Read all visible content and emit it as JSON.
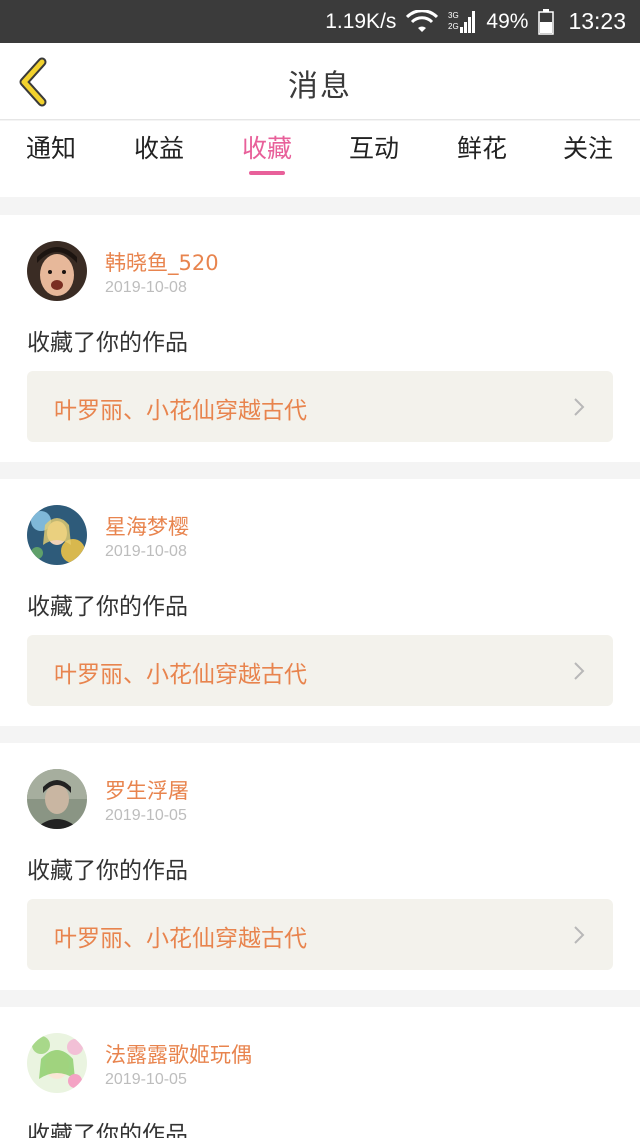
{
  "status_bar": {
    "net_speed": "1.19K/s",
    "network": "3G 2G",
    "battery": "49%",
    "time": "13:23"
  },
  "header": {
    "title": "消息",
    "back_icon": "chevron-left-icon"
  },
  "tabs": [
    {
      "label": "通知",
      "active": false
    },
    {
      "label": "收益",
      "active": false
    },
    {
      "label": "收藏",
      "active": true
    },
    {
      "label": "互动",
      "active": false
    },
    {
      "label": "鲜花",
      "active": false
    },
    {
      "label": "关注",
      "active": false
    }
  ],
  "messages": [
    {
      "username": "韩晓鱼_520",
      "date": "2019-10-08",
      "action": "收藏了你的作品",
      "work_title": "叶罗丽、小花仙穿越古代"
    },
    {
      "username": "星海梦樱",
      "date": "2019-10-08",
      "action": "收藏了你的作品",
      "work_title": "叶罗丽、小花仙穿越古代"
    },
    {
      "username": "罗生浮屠",
      "date": "2019-10-05",
      "action": "收藏了你的作品",
      "work_title": "叶罗丽、小花仙穿越古代"
    },
    {
      "username": "法露露歌姬玩偶",
      "date": "2019-10-05",
      "action": "收藏了你的作品",
      "work_title": ""
    }
  ],
  "colors": {
    "accent_pink": "#e8609a",
    "username_orange": "#e8844e",
    "back_arrow_yellow": "#f2d22e",
    "status_bar_bg": "#3b3b3b"
  }
}
